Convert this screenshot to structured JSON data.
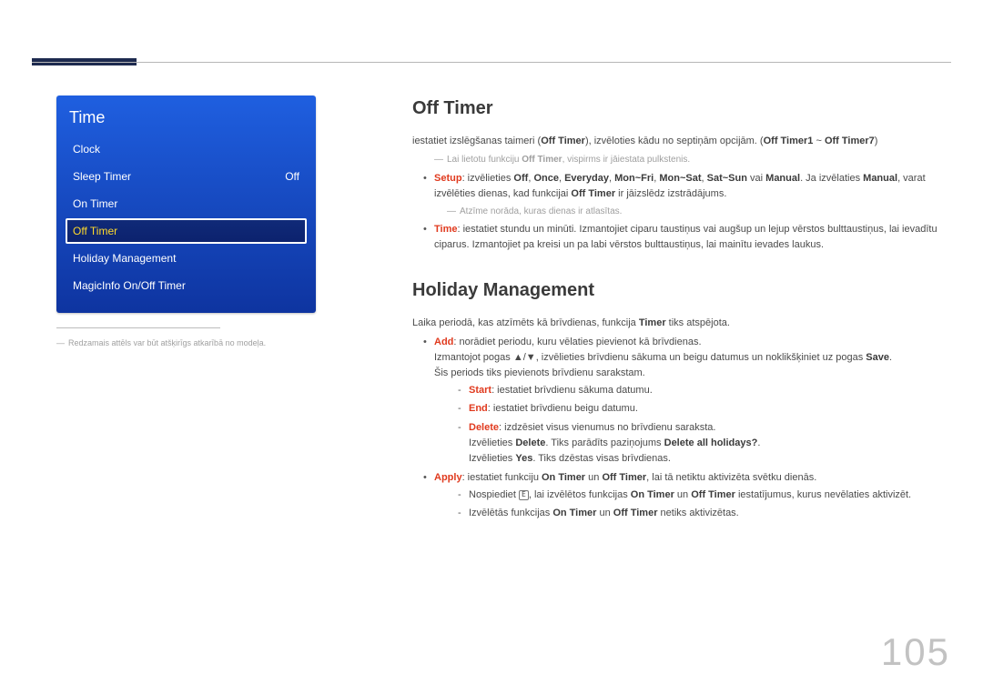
{
  "page_number": "105",
  "menu": {
    "title": "Time",
    "items": [
      {
        "label": "Clock",
        "value": ""
      },
      {
        "label": "Sleep Timer",
        "value": "Off"
      },
      {
        "label": "On Timer",
        "value": ""
      },
      {
        "label": "Off Timer",
        "value": ""
      },
      {
        "label": "Holiday Management",
        "value": ""
      },
      {
        "label": "MagicInfo On/Off Timer",
        "value": ""
      }
    ]
  },
  "left_note": {
    "text": "Redzamais attēls var būt atšķirīgs atkarībā no modeļa."
  },
  "section1": {
    "heading": "Off Timer",
    "intro_pre": "iestatiet izslēgšanas taimeri (",
    "intro_bold1": "Off Timer",
    "intro_mid": "), izvēloties kādu no septiņām opcijām. (",
    "intro_bold2": "Off Timer1",
    "intro_tilde": " ~ ",
    "intro_bold3": "Off Timer7",
    "intro_end": ")",
    "note_pre": "Lai lietotu funkciju ",
    "note_bold": "Off Timer",
    "note_post": ", vispirms ir jāiestata pulkstenis.",
    "setup": {
      "label": "Setup",
      "pre": ": izvēlieties ",
      "opt1": "Off",
      "opt2": "Once",
      "opt3": "Everyday",
      "opt4": "Mon~Fri",
      "opt5": "Mon~Sat",
      "opt6": "Sat~Sun",
      "or": " vai ",
      "opt7": "Manual",
      "mid": ". Ja izvēlaties ",
      "manual": "Manual",
      "mid2": ", varat izvēlēties dienas, kad funkcijai ",
      "offtimer": "Off Timer",
      "post": " ir jāizslēdz izstrādājums.",
      "note": "Atzīme norāda, kuras dienas ir atlasītas."
    },
    "time": {
      "label": "Time",
      "text": ": iestatiet stundu un minūti. Izmantojiet ciparu taustiņus vai augšup un lejup vērstos bulttaustiņus, lai ievadītu ciparus. Izmantojiet pa kreisi un pa labi vērstos bulttaustiņus, lai mainītu ievades laukus."
    }
  },
  "section2": {
    "heading": "Holiday Management",
    "intro_pre": "Laika periodā, kas atzīmēts kā brīvdienas, funkcija ",
    "intro_bold": "Timer",
    "intro_post": " tiks atspējota.",
    "add": {
      "label": "Add",
      "text": ": norādiet periodu, kuru vēlaties pievienot kā brīvdienas.",
      "line2_pre": "Izmantojot pogas ",
      "line2_mid": ", izvēlieties brīvdienu sākuma un beigu datumus un noklikšķiniet uz pogas ",
      "line2_bold": "Save",
      "line2_end": ".",
      "line3": "Šis periods tiks pievienots brīvdienu sarakstam."
    },
    "start": {
      "label": "Start",
      "text": ": iestatiet brīvdienu sākuma datumu."
    },
    "end": {
      "label": "End",
      "text": ": iestatiet brīvdienu beigu datumu."
    },
    "delete": {
      "label": "Delete",
      "text": ": izdzēsiet visus vienumus no brīvdienu saraksta.",
      "line2_pre": "Izvēlieties ",
      "line2_b1": "Delete",
      "line2_mid": ". Tiks parādīts paziņojums ",
      "line2_b2": "Delete all holidays?",
      "line2_end": ".",
      "line3_pre": "Izvēlieties ",
      "line3_b": "Yes",
      "line3_post": ". Tiks dzēstas visas brīvdienas."
    },
    "apply": {
      "label": "Apply",
      "pre": ": iestatiet funkciju ",
      "b1": "On Timer",
      "and": " un ",
      "b2": "Off Timer",
      "post": ", lai tā netiktu aktivizēta svētku dienās.",
      "d1_pre": "Nospiediet ",
      "d1_icon": "E",
      "d1_mid": ", lai izvēlētos funkcijas ",
      "d1_b1": "On Timer",
      "d1_and": " un ",
      "d1_b2": "Off Timer",
      "d1_post": " iestatījumus, kurus nevēlaties aktivizēt.",
      "d2_pre": "Izvēlētās funkcijas ",
      "d2_b1": "On Timer",
      "d2_and": " un ",
      "d2_b2": "Off Timer",
      "d2_post": " netiks aktivizētas."
    }
  }
}
